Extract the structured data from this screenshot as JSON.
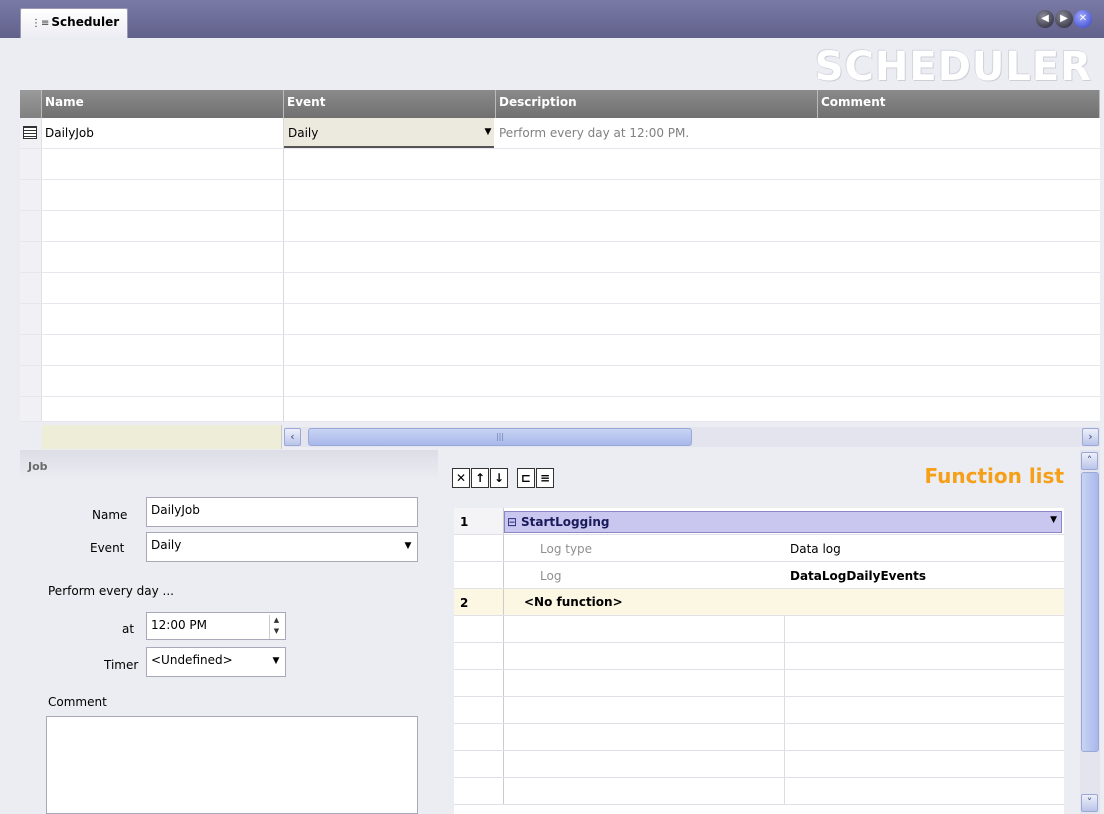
{
  "tab": {
    "icon": "⋮≡",
    "label": "Scheduler"
  },
  "window_controls": {
    "back_icon": "◀",
    "forward_icon": "▶",
    "close_icon": "✕"
  },
  "banner": "SCHEDULER",
  "grid": {
    "columns": [
      "Name",
      "Event",
      "Description",
      "Comment"
    ],
    "rows": [
      {
        "name": "DailyJob",
        "event": "Daily",
        "description": "Perform every day at 12:00 PM.",
        "comment": ""
      }
    ]
  },
  "scrollbar": {
    "left_icon": "‹",
    "right_icon": "›",
    "thumb_grip": "|||"
  },
  "job": {
    "header": "Job",
    "name_label": "Name",
    "name_value": "DailyJob",
    "event_label": "Event",
    "event_value": "Daily",
    "perform_text": "Perform every day ...",
    "at_label": "at",
    "at_value": "12:00 PM",
    "timer_label": "Timer",
    "timer_value": "<Undefined>",
    "comment_label": "Comment",
    "comment_value": ""
  },
  "function_list": {
    "title": "Function list",
    "toolbar": [
      "✕",
      "↑",
      "↓",
      "⊏",
      "≡"
    ],
    "rows": [
      {
        "num": "1",
        "function": "StartLogging",
        "expand_icon": "⊟"
      },
      {
        "param": "Log type",
        "value": "Data log"
      },
      {
        "param": "Log",
        "value": "DataLogDailyEvents"
      },
      {
        "num": "2",
        "function": "<No function>"
      }
    ]
  },
  "colors": {
    "accent_orange": "#f5a018",
    "header_gray": "#707070",
    "tabstrip": "#6a6a96",
    "selected_func": "#c9c6f0"
  }
}
